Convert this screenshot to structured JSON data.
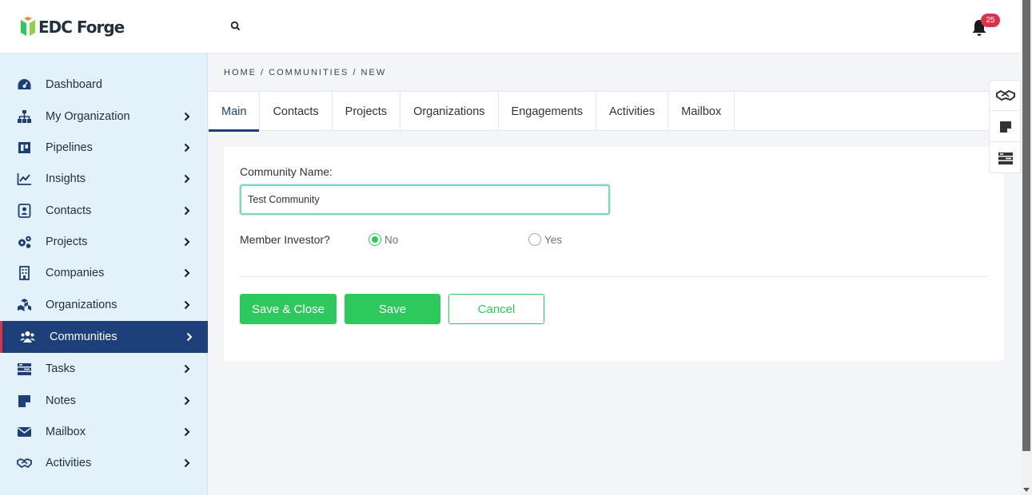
{
  "app": {
    "name": "EDC Forge"
  },
  "header": {
    "notification_count": "25"
  },
  "sidebar": {
    "items": [
      {
        "label": "Dashboard",
        "icon": "dashboard-icon"
      },
      {
        "label": "My Organization",
        "icon": "org-chart-icon"
      },
      {
        "label": "Pipelines",
        "icon": "pipeline-icon"
      },
      {
        "label": "Insights",
        "icon": "line-chart-icon"
      },
      {
        "label": "Contacts",
        "icon": "contact-card-icon"
      },
      {
        "label": "Projects",
        "icon": "gears-icon"
      },
      {
        "label": "Companies",
        "icon": "building-icon"
      },
      {
        "label": "Organizations",
        "icon": "cubes-icon"
      },
      {
        "label": "Communities",
        "icon": "users-icon",
        "active": true
      },
      {
        "label": "Tasks",
        "icon": "tasks-icon"
      },
      {
        "label": "Notes",
        "icon": "sticky-note-icon"
      },
      {
        "label": "Mailbox",
        "icon": "envelope-icon"
      },
      {
        "label": "Activities",
        "icon": "handshake-icon"
      }
    ]
  },
  "breadcrumb": "HOME / COMMUNITIES / NEW",
  "tabs": [
    {
      "label": "Main",
      "active": true
    },
    {
      "label": "Contacts"
    },
    {
      "label": "Projects"
    },
    {
      "label": "Organizations"
    },
    {
      "label": "Engagements"
    },
    {
      "label": "Activities"
    },
    {
      "label": "Mailbox"
    }
  ],
  "form": {
    "community_name_label": "Community Name:",
    "community_name_value": "Test Community",
    "member_investor_label": "Member Investor?",
    "member_investor_options": [
      {
        "label": "No",
        "selected": true
      },
      {
        "label": "Yes",
        "selected": false
      }
    ]
  },
  "buttons": {
    "save_close": "Save & Close",
    "save": "Save",
    "cancel": "Cancel"
  },
  "colors": {
    "primary": "#1d3f7a",
    "accent_green": "#2ec95c",
    "badge_red": "#d9344a",
    "sidebar_bg": "#e3f1fb"
  }
}
